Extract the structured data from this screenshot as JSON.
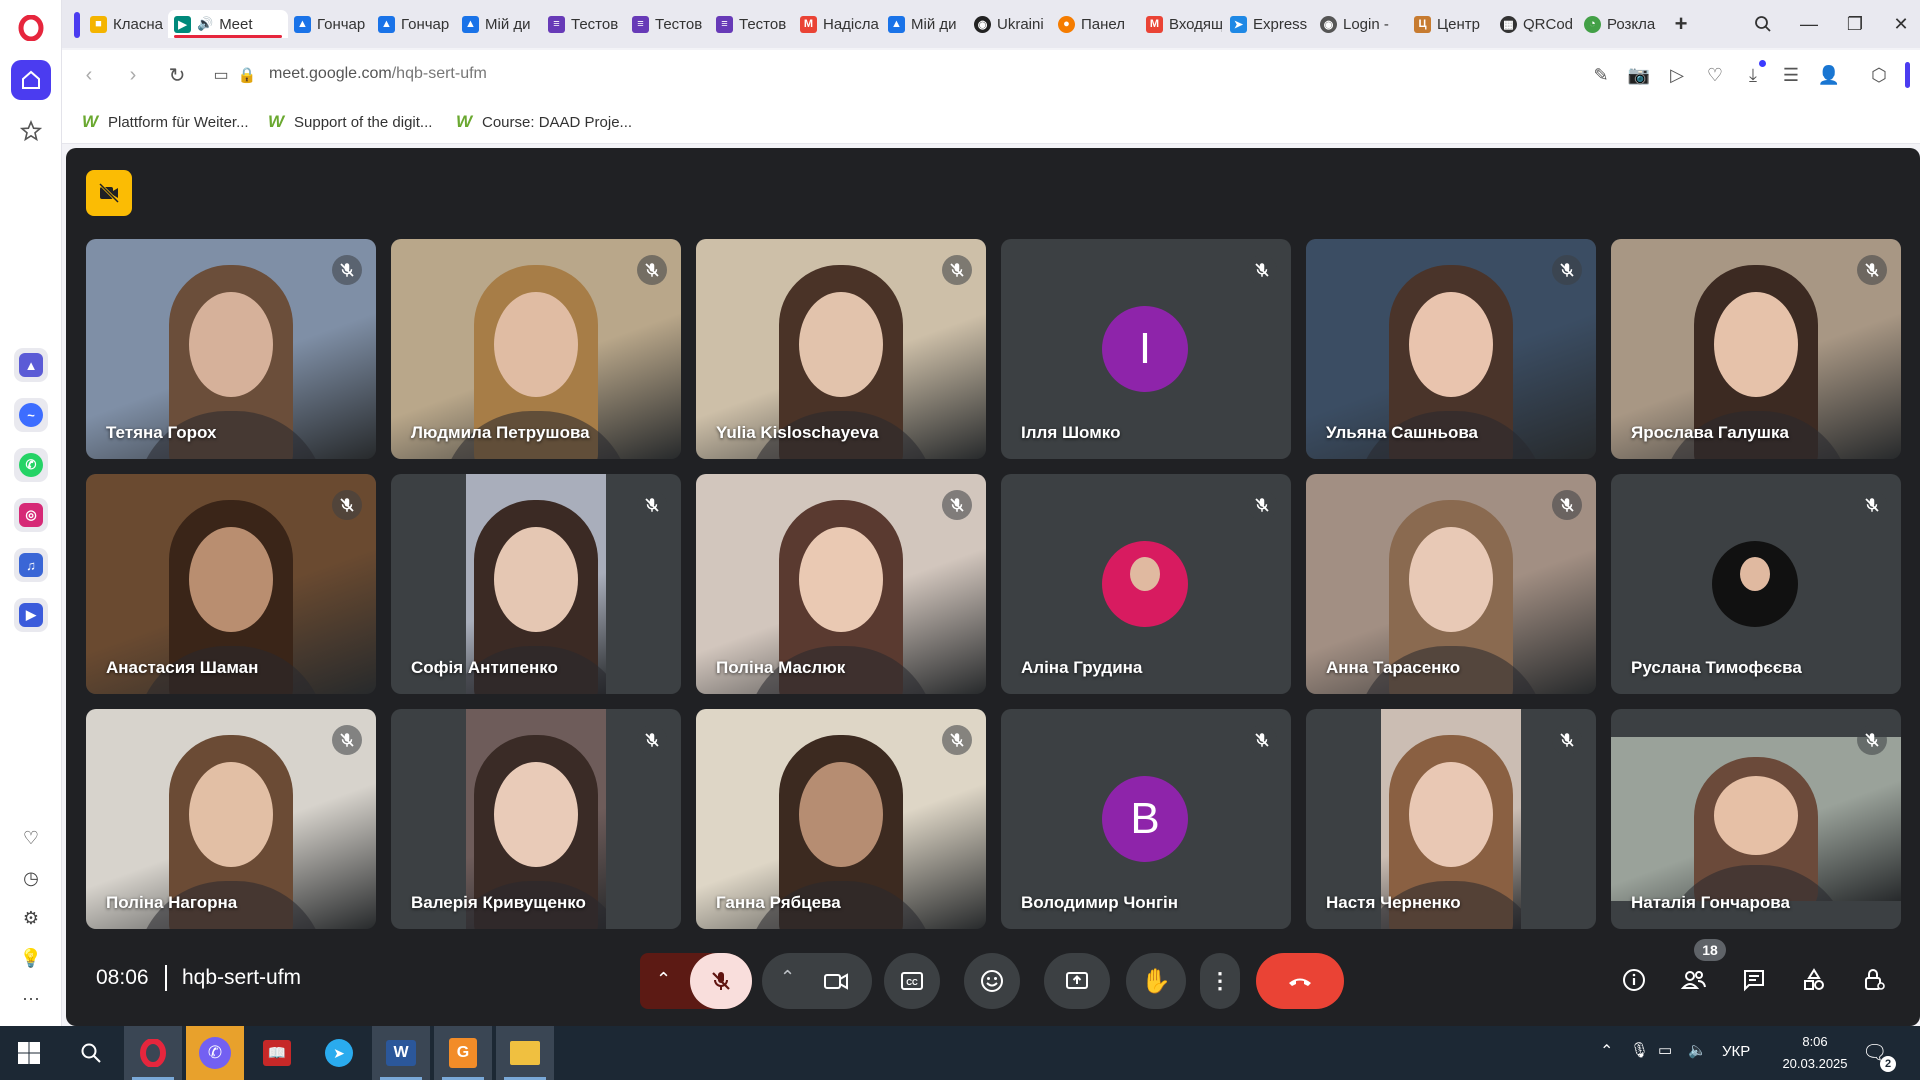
{
  "browser": {
    "tabs": [
      {
        "label": "Класна",
        "icon": "google-classroom-icon",
        "color": "#f4b400"
      },
      {
        "label": "Meet",
        "icon": "google-meet-icon",
        "color": "#00897b",
        "active": true
      },
      {
        "label": "Гончар",
        "icon": "google-drive-icon",
        "color": "#1a73e8"
      },
      {
        "label": "Гончар",
        "icon": "google-drive-icon",
        "color": "#1a73e8"
      },
      {
        "label": "Мій ди",
        "icon": "google-drive-icon",
        "color": "#1a73e8"
      },
      {
        "label": "Тестов",
        "icon": "google-forms-icon",
        "color": "#673ab7"
      },
      {
        "label": "Тестов",
        "icon": "google-forms-icon",
        "color": "#673ab7"
      },
      {
        "label": "Тестов",
        "icon": "google-forms-icon",
        "color": "#673ab7"
      },
      {
        "label": "Надісла",
        "icon": "gmail-icon",
        "color": "#ea4335"
      },
      {
        "label": "Мій ди",
        "icon": "google-drive-icon",
        "color": "#1a73e8"
      },
      {
        "label": "Ukraini",
        "icon": "globe-icon",
        "color": "#222222"
      },
      {
        "label": "Панел",
        "icon": "orange-circle-icon",
        "color": "#f57c00"
      },
      {
        "label": "Входящ",
        "icon": "gmail-icon",
        "color": "#ea4335"
      },
      {
        "label": "Express",
        "icon": "paper-plane-icon",
        "color": "#1e88e5"
      },
      {
        "label": "Login -",
        "icon": "globe-icon",
        "color": "#555555"
      },
      {
        "label": "Центр",
        "icon": "diia-icon",
        "color": "#c77b30"
      },
      {
        "label": "QRCod",
        "icon": "qr-icon",
        "color": "#333333"
      },
      {
        "label": "Розкла",
        "icon": "schedule-icon",
        "color": "#43a047"
      }
    ],
    "url": {
      "host": "meet.google.com",
      "path": "/hqb-sert-ufm"
    },
    "bookmarks": [
      "Plattform für Weiter...",
      "Support of the digit...",
      "Course: DAAD Proje..."
    ]
  },
  "meet": {
    "time": "08:06",
    "meeting_code": "hqb-sert-ufm",
    "participant_count": "18",
    "participants": [
      {
        "name": "Тетяна Горох",
        "kind": "video",
        "bg": "#7f8fa6",
        "skin": "#d6b19a",
        "hair": "#6b4e3a"
      },
      {
        "name": "Людмила Петрушова",
        "kind": "video",
        "bg": "#b9a78a",
        "skin": "#e0bca3",
        "hair": "#a77d47"
      },
      {
        "name": "Yulia Kisloschayeva",
        "kind": "video",
        "bg": "#cdbfa8",
        "skin": "#e2c3ac",
        "hair": "#4a3327"
      },
      {
        "name": "Ілля Шомко",
        "kind": "avatar",
        "letter": "I",
        "color": "#8e24aa"
      },
      {
        "name": "Ульяна Сашньова",
        "kind": "video",
        "bg": "#3b4d63",
        "skin": "#e9c4ae",
        "hair": "#4a342a"
      },
      {
        "name": "Ярослава Галушка",
        "kind": "video",
        "bg": "#a89784",
        "skin": "#e6c2aa",
        "hair": "#3c2a22"
      },
      {
        "name": "Анастасия Шаман",
        "kind": "video",
        "bg": "#6a4a30",
        "skin": "#b98e70",
        "hair": "#3a2518"
      },
      {
        "name": "Софія Антипенко",
        "kind": "video",
        "bg": "#a9aebb",
        "skin": "#e5c7b3",
        "hair": "#3b2a24",
        "narrow": true
      },
      {
        "name": "Поліна Маслюк",
        "kind": "video",
        "bg": "#d2c6bd",
        "skin": "#eac9b3",
        "hair": "#5a3a30"
      },
      {
        "name": "Аліна Грудина",
        "kind": "photo-avatar",
        "color": "#d81b60"
      },
      {
        "name": "Анна Тарасенко",
        "kind": "video",
        "bg": "#a28f83",
        "skin": "#e8c9b6",
        "hair": "#8a6a50"
      },
      {
        "name": "Руслана Тимофєєва",
        "kind": "photo-avatar",
        "color": "#111111"
      },
      {
        "name": "Поліна Нагорна",
        "kind": "video",
        "bg": "#d7d3cc",
        "skin": "#e2bfa5",
        "hair": "#6b4b35"
      },
      {
        "name": "Валерія Кривущенко",
        "kind": "video",
        "bg": "#6e5c5a",
        "skin": "#e9cbb8",
        "hair": "#3a2b26",
        "narrow": true
      },
      {
        "name": "Ганна Рябцева",
        "kind": "video",
        "bg": "#ded6c6",
        "skin": "#b68d72",
        "hair": "#3c2a20"
      },
      {
        "name": "Володимир Чонгін",
        "kind": "avatar",
        "letter": "В",
        "color": "#8e24aa"
      },
      {
        "name": "Настя Черненко",
        "kind": "video",
        "bg": "#cbbdb3",
        "skin": "#e9c8b4",
        "hair": "#8a6042",
        "narrow": true
      },
      {
        "name": "Наталія Гончарова",
        "kind": "video",
        "bg": "#9aa29a",
        "skin": "#e6c0a6",
        "hair": "#6b4a3a",
        "letterbox": true
      }
    ]
  },
  "taskbar": {
    "language": "УКР",
    "time": "8:06",
    "date": "20.03.2025",
    "notifications": "2"
  }
}
